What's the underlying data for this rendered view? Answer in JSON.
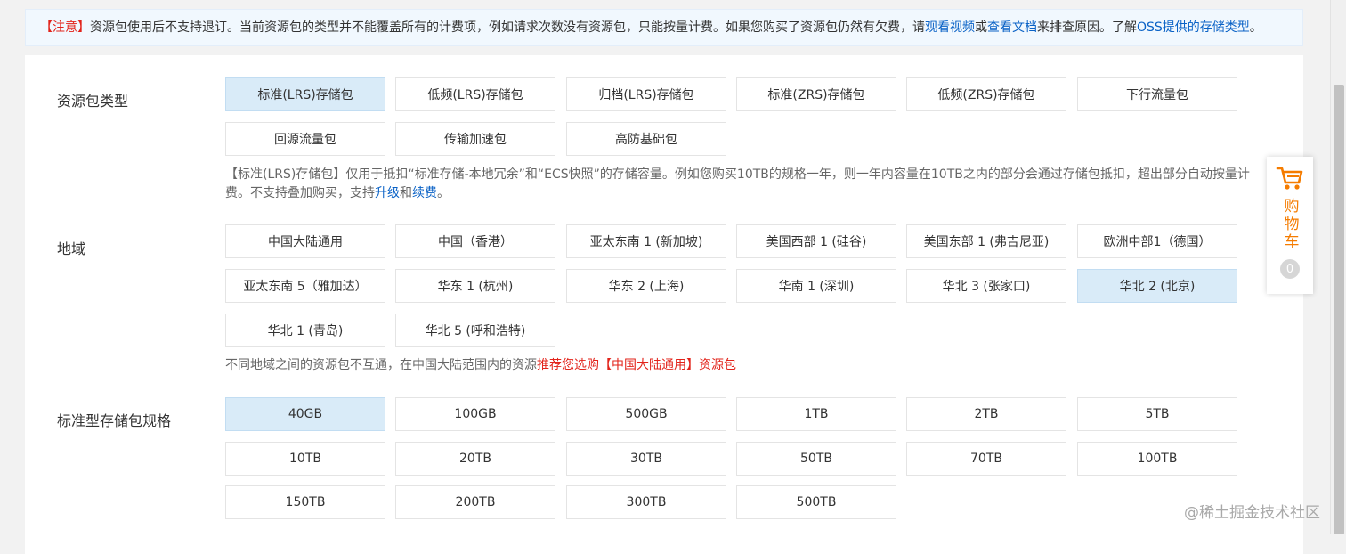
{
  "notice": {
    "tag": "【注意】",
    "text1": "资源包使用后不支持退订。当前资源包的类型并不能覆盖所有的计费项，例如请求次数没有资源包，只能按量计费。如果您购买了资源包仍然有欠费，请",
    "link_video": "观看视频",
    "or": "或",
    "link_doc": "查看文档",
    "text2": "来排查原因。了解",
    "link_oss": "OSS提供的存储类型",
    "end": "。"
  },
  "package_type": {
    "label": "资源包类型",
    "options": [
      "标准(LRS)存储包",
      "低频(LRS)存储包",
      "归档(LRS)存储包",
      "标准(ZRS)存储包",
      "低频(ZRS)存储包",
      "下行流量包",
      "回源流量包",
      "传输加速包",
      "高防基础包"
    ],
    "selected": "标准(LRS)存储包",
    "desc": {
      "text1": "【标准(LRS)存储包】仅用于抵扣“标准存储-本地冗余”和“ECS快照”的存储容量。例如您购买10TB的规格一年，则一年内容量在10TB之内的部分会通过存储包抵扣，超出部分自动按量计费。不支持叠加购买，支持",
      "link_upgrade": "升级",
      "and": "和",
      "link_renew": "续费",
      "end": "。"
    }
  },
  "region": {
    "label": "地域",
    "options": [
      "中国大陆通用",
      "中国（香港）",
      "亚太东南 1 (新加坡)",
      "美国西部 1 (硅谷)",
      "美国东部 1 (弗吉尼亚)",
      "欧洲中部1（德国）",
      "亚太东南 5（雅加达）",
      "华东 1 (杭州)",
      "华东 2 (上海)",
      "华南 1 (深圳)",
      "华北 3 (张家口)",
      "华北 2 (北京)",
      "华北 1 (青岛)",
      "华北 5 (呼和浩特)"
    ],
    "selected": "华北 2 (北京)",
    "desc": {
      "text1": "不同地域之间的资源包不互通，在中国大陆范围内的资源",
      "recommend": "推荐您选购【中国大陆通用】资源包"
    }
  },
  "spec": {
    "label": "标准型存储包规格",
    "options": [
      "40GB",
      "100GB",
      "500GB",
      "1TB",
      "2TB",
      "5TB",
      "10TB",
      "20TB",
      "30TB",
      "50TB",
      "70TB",
      "100TB",
      "150TB",
      "200TB",
      "300TB",
      "500TB"
    ],
    "selected": "40GB"
  },
  "cart": {
    "text": "购物车",
    "count": "0"
  },
  "watermark": "@稀土掘金技术社区",
  "colors": {
    "accent": "#0a62c6",
    "warning": "#e2231a",
    "selected_bg": "#d9ebf8",
    "cart_orange": "#f57c00"
  }
}
